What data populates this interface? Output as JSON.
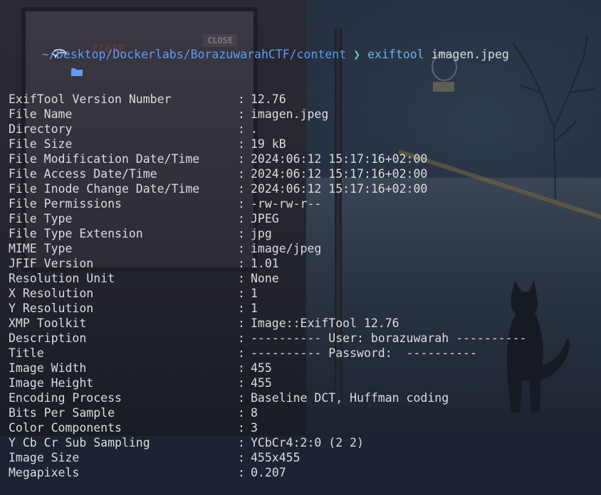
{
  "prompt": {
    "path": "~/Desktop/Dockerlabs/BorazuwarahCTF/content",
    "command": "exiftool",
    "argument": "imagen.jpeg"
  },
  "wallpaper": {
    "sign_text_1": "CLOSE",
    "sign_text_2": "CLOSE"
  },
  "separator": ":",
  "rows": [
    {
      "key": "ExifTool Version Number",
      "value": "12.76"
    },
    {
      "key": "File Name",
      "value": "imagen.jpeg"
    },
    {
      "key": "Directory",
      "value": "."
    },
    {
      "key": "File Size",
      "value": "19 kB"
    },
    {
      "key": "File Modification Date/Time",
      "value": "2024:06:12 15:17:16+02:00"
    },
    {
      "key": "File Access Date/Time",
      "value": "2024:06:12 15:17:16+02:00"
    },
    {
      "key": "File Inode Change Date/Time",
      "value": "2024:06:12 15:17:16+02:00"
    },
    {
      "key": "File Permissions",
      "value": "-rw-rw-r--"
    },
    {
      "key": "File Type",
      "value": "JPEG"
    },
    {
      "key": "File Type Extension",
      "value": "jpg"
    },
    {
      "key": "MIME Type",
      "value": "image/jpeg"
    },
    {
      "key": "JFIF Version",
      "value": "1.01"
    },
    {
      "key": "Resolution Unit",
      "value": "None"
    },
    {
      "key": "X Resolution",
      "value": "1"
    },
    {
      "key": "Y Resolution",
      "value": "1"
    },
    {
      "key": "XMP Toolkit",
      "value": "Image::ExifTool 12.76"
    },
    {
      "key": "Description",
      "value": "---------- User: borazuwarah ----------"
    },
    {
      "key": "Title",
      "value": "---------- Password:  ----------"
    },
    {
      "key": "Image Width",
      "value": "455"
    },
    {
      "key": "Image Height",
      "value": "455"
    },
    {
      "key": "Encoding Process",
      "value": "Baseline DCT, Huffman coding"
    },
    {
      "key": "Bits Per Sample",
      "value": "8"
    },
    {
      "key": "Color Components",
      "value": "3"
    },
    {
      "key": "Y Cb Cr Sub Sampling",
      "value": "YCbCr4:2:0 (2 2)"
    },
    {
      "key": "Image Size",
      "value": "455x455"
    },
    {
      "key": "Megapixels",
      "value": "0.207"
    }
  ],
  "colors": {
    "path": "#5c9cf5",
    "arrow": "#5cd1a0",
    "command": "#6cb4ee",
    "text": "#dcdcdc"
  }
}
